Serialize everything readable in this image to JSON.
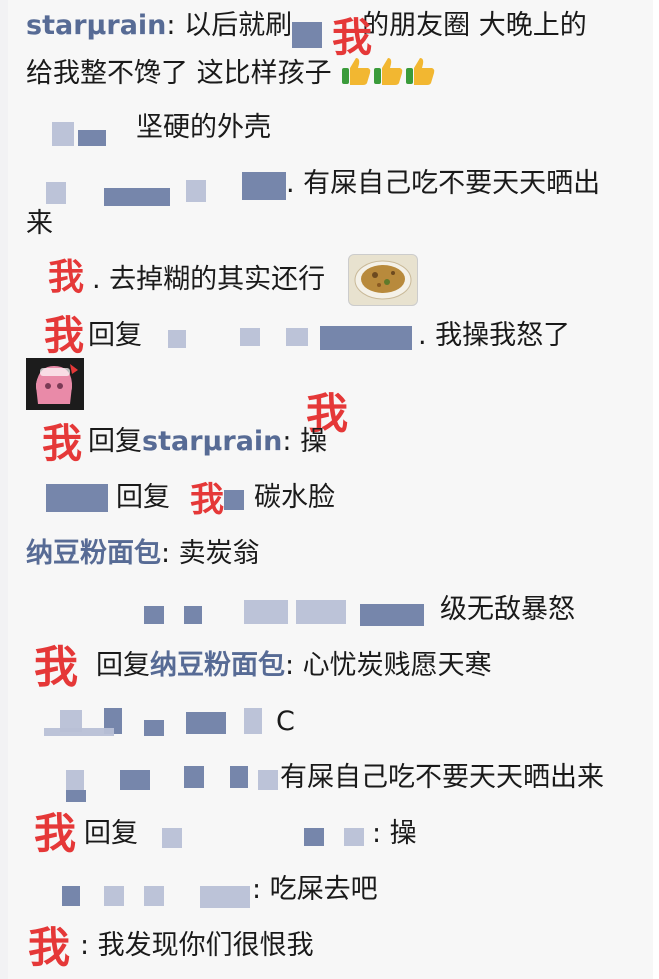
{
  "comments": [
    {
      "name": "starµrain",
      "sep": ":",
      "text_a": "以后就刷",
      "text_b": "的朋友圈 大晚上的"
    },
    {
      "text": "给我整不馋了 这比样孩子",
      "emoji": [
        "thumbs-up",
        "thumbs-up",
        "thumbs-up"
      ]
    },
    {
      "text": "坚硬的外壳"
    },
    {
      "text": ". 有屎自己吃不要天天晒出"
    },
    {
      "text": "来"
    },
    {
      "text": ". 去掉糊的其实还行"
    },
    {
      "reply": "回复",
      "text": ". 我操我怒了"
    },
    {
      "reply": "回复",
      "name": "starµrain",
      "text": ": 操"
    },
    {
      "reply": "回复",
      "text": "碳水脸"
    },
    {
      "name": "纳豆粉面包",
      "text": ": 卖炭翁"
    },
    {
      "text": "级无敌暴怒"
    },
    {
      "reply": "回复",
      "name": "纳豆粉面包",
      "text": ": 心忧炭贱愿天寒"
    },
    {
      "text": "C"
    },
    {
      "text": "有屎自己吃不要天天晒出来"
    },
    {
      "reply": "回复",
      "text": ": 操"
    },
    {
      "text": ": 吃屎去吧"
    },
    {
      "text": ": 我发现你们很恨我"
    }
  ],
  "overlay_me": "我",
  "colors": {
    "name": "#576b95",
    "me": "#e53838",
    "text": "#1a1a1a"
  }
}
